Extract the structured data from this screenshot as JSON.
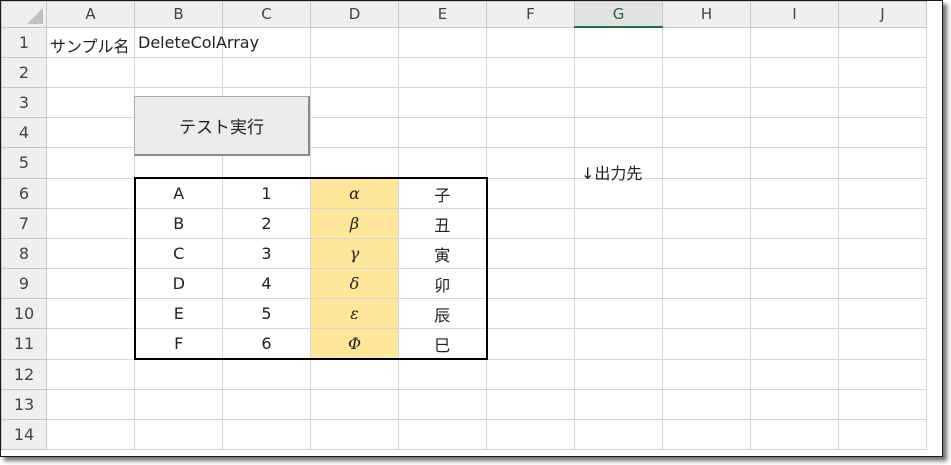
{
  "columns": [
    "A",
    "B",
    "C",
    "D",
    "E",
    "F",
    "G",
    "H",
    "I",
    "J"
  ],
  "rows": [
    "1",
    "2",
    "3",
    "4",
    "5",
    "6",
    "7",
    "8",
    "9",
    "10",
    "11",
    "12",
    "13",
    "14"
  ],
  "sample_name_label": "サンプル名",
  "sample_name_value": "DeleteColArray",
  "run_button_label": "テスト実行",
  "output_label": "↓出力先",
  "data_table": [
    [
      "A",
      "1",
      "α",
      "子"
    ],
    [
      "B",
      "2",
      "β",
      "丑"
    ],
    [
      "C",
      "3",
      "γ",
      "寅"
    ],
    [
      "D",
      "4",
      "δ",
      "卯"
    ],
    [
      "E",
      "5",
      "ε",
      "辰"
    ],
    [
      "F",
      "6",
      "Φ",
      "巳"
    ]
  ],
  "selected_column": "G",
  "highlight_color": "#ffe699"
}
